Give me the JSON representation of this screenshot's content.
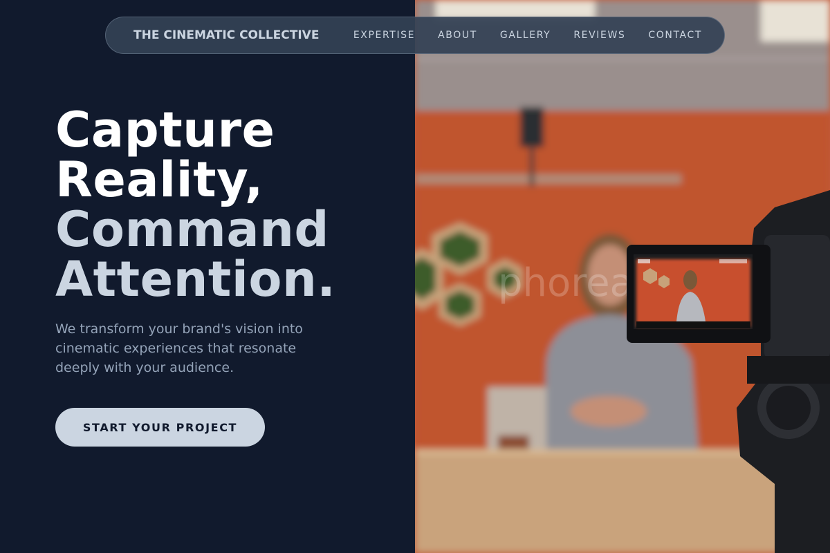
{
  "nav": {
    "brand": "THE CINEMATIC COLLECTIVE",
    "links": [
      "EXPERTISE",
      "ABOUT",
      "GALLERY",
      "REVIEWS",
      "CONTACT"
    ]
  },
  "hero": {
    "headline_lines": [
      "Capture",
      "Reality,",
      "Command",
      "Attention."
    ],
    "subtext": "We transform your brand's vision into cinematic experiences that resonate deeply with your audience.",
    "cta_label": "START YOUR PROJECT"
  },
  "photo": {
    "watermark": "phorearast",
    "description_icon": "camera-filming-presenter-photo"
  },
  "colors": {
    "background": "#111a2d",
    "accent": "#cbd5e1",
    "muted_text": "#94a3b8",
    "nav_bg": "#334155",
    "wall_orange": "#c25a3a"
  }
}
